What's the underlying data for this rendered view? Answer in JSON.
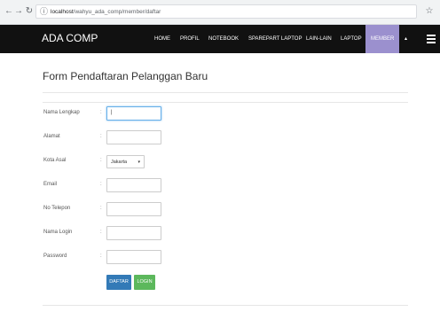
{
  "browser": {
    "url_host": "localhost",
    "url_path": "/wahyu_ada_comp/member/daftar"
  },
  "navbar": {
    "brand": "ADA COMP",
    "items": [
      {
        "label": "HOME",
        "active": false
      },
      {
        "label": "PROFIL",
        "active": false
      },
      {
        "label": "NOTEBOOK",
        "active": false
      },
      {
        "label": "SPAREPART LAPTOP",
        "active": false
      },
      {
        "label": "LAIN-LAIN",
        "active": false
      },
      {
        "label": "LAPTOP",
        "active": false
      },
      {
        "label": "MEMBER",
        "active": true
      }
    ],
    "caret": "▴"
  },
  "form": {
    "title": "Form Pendaftaran Pelanggan Baru",
    "colon": ":",
    "fields": [
      {
        "label": "Nama Lengkap",
        "value": "|"
      },
      {
        "label": "Alamat",
        "value": ""
      },
      {
        "label": "Kota Asal",
        "value": "Jakarta"
      },
      {
        "label": "Email",
        "value": ""
      },
      {
        "label": "No Telepon",
        "value": ""
      },
      {
        "label": "Nama Login",
        "value": ""
      },
      {
        "label": "Password",
        "value": ""
      }
    ],
    "buttons": {
      "daftar": "DAFTAR",
      "login": "LOGIN"
    }
  },
  "colors": {
    "navbar_bg": "#111111",
    "active_menu": "#9b90ce",
    "daftar_btn": "#337ab7",
    "login_btn": "#5cb85c"
  }
}
